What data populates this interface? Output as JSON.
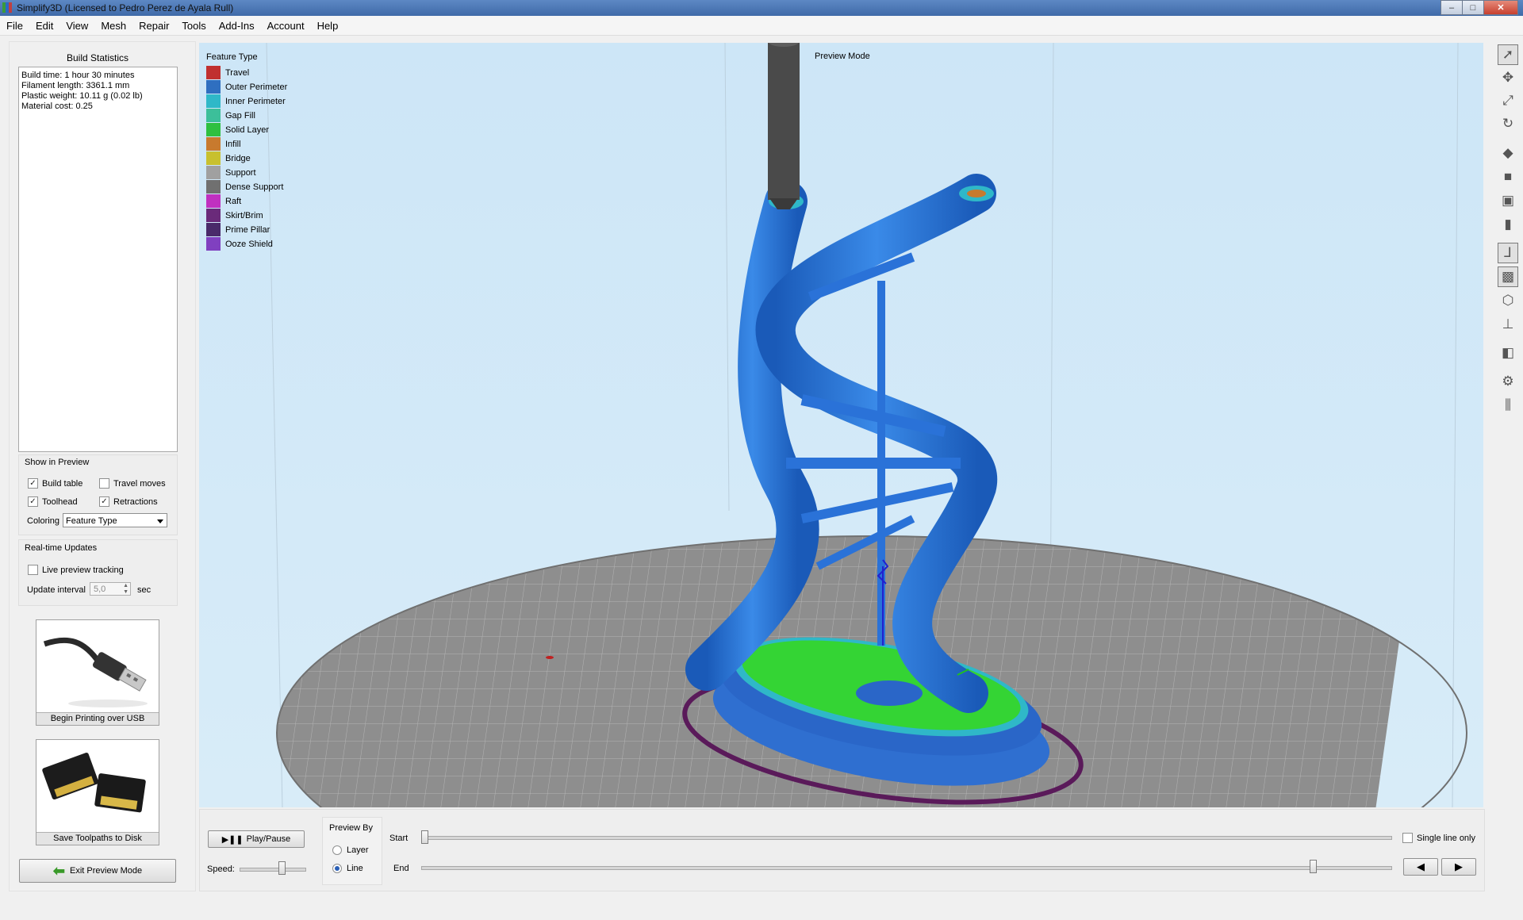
{
  "window": {
    "title": "Simplify3D (Licensed to Pedro Perez de Ayala Rull)",
    "min_label": "–",
    "max_label": "□",
    "close_label": "✕"
  },
  "menu": [
    "File",
    "Edit",
    "View",
    "Mesh",
    "Repair",
    "Tools",
    "Add-Ins",
    "Account",
    "Help"
  ],
  "build_statistics": {
    "title": "Build Statistics",
    "lines": [
      "Build time: 1 hour 30 minutes",
      "Filament length: 3361.1 mm",
      "Plastic weight: 10.11 g (0.02 lb)",
      "Material cost: 0.25"
    ]
  },
  "show_in_preview": {
    "title": "Show in Preview",
    "build_table": {
      "label": "Build table",
      "checked": true
    },
    "travel_moves": {
      "label": "Travel moves",
      "checked": false
    },
    "toolhead": {
      "label": "Toolhead",
      "checked": true
    },
    "retractions": {
      "label": "Retractions",
      "checked": true
    },
    "coloring_label": "Coloring",
    "coloring_value": "Feature Type"
  },
  "realtime_updates": {
    "title": "Real-time Updates",
    "live_tracking": {
      "label": "Live preview tracking",
      "checked": false
    },
    "interval_label": "Update interval",
    "interval_value": "5,0",
    "interval_unit": "sec"
  },
  "actions": {
    "usb_label": "Begin Printing over USB",
    "disk_label": "Save Toolpaths to Disk",
    "exit_label": "Exit Preview Mode"
  },
  "legend": {
    "title": "Feature Type",
    "items": [
      {
        "label": "Travel",
        "color": "#c03030"
      },
      {
        "label": "Outer Perimeter",
        "color": "#2f6fc0"
      },
      {
        "label": "Inner Perimeter",
        "color": "#2fb8c8"
      },
      {
        "label": "Gap Fill",
        "color": "#3cbf9a"
      },
      {
        "label": "Solid Layer",
        "color": "#2ec040"
      },
      {
        "label": "Infill",
        "color": "#c87a2e"
      },
      {
        "label": "Bridge",
        "color": "#c8c02e"
      },
      {
        "label": "Support",
        "color": "#a0a0a0"
      },
      {
        "label": "Dense Support",
        "color": "#707070"
      },
      {
        "label": "Raft",
        "color": "#c030c0"
      },
      {
        "label": "Skirt/Brim",
        "color": "#6a2a7a"
      },
      {
        "label": "Prime Pillar",
        "color": "#4a2a6a"
      },
      {
        "label": "Ooze Shield",
        "color": "#8040c0"
      }
    ]
  },
  "viewport": {
    "mode_label": "Preview Mode"
  },
  "playback": {
    "play_label": "Play/Pause",
    "speed_label": "Speed:",
    "speed_fraction": 0.65,
    "preview_by_title": "Preview By",
    "layer_label": "Layer",
    "line_label": "Line",
    "selected": "Line",
    "start_label": "Start",
    "end_label": "End",
    "start_fraction": 0.0,
    "end_fraction": 0.92,
    "single_line_label": "Single line only",
    "single_line_checked": false
  },
  "right_toolbar": [
    "select-icon",
    "move-icon",
    "scale-icon",
    "rotate-icon",
    "iso-view-icon",
    "front-view-icon",
    "top-view-icon",
    "side-view-icon",
    "axes-icon",
    "solid-view-icon",
    "wireframe-icon",
    "normals-icon",
    "cross-section-icon",
    "settings-icon",
    "support-icon"
  ]
}
